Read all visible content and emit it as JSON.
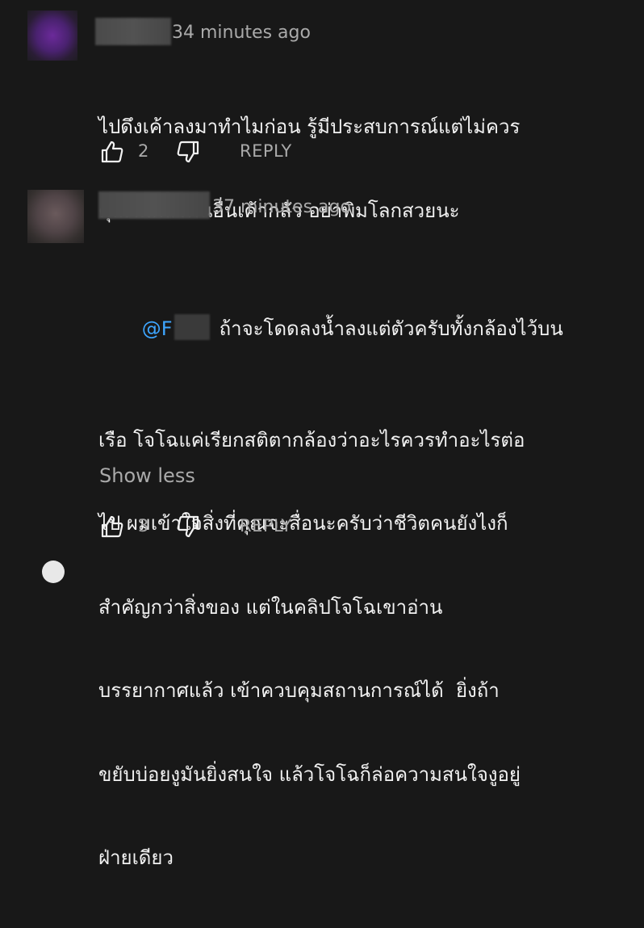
{
  "comments": [
    {
      "time": "34 minutes ago",
      "lines": [
        "ไปดึงเค้าลงมาทำไมก่อน รู้มีประสบการณ์แต่ไม่ควร",
        "คุณไม่กลัวคนอื่นเค้ากลัว อย่าพิมโลกสวยนะ"
      ],
      "like_count": "2",
      "reply_label": "REPLY"
    },
    {
      "time": "37 minutes ago",
      "mention": "@F",
      "first_line": "ถ้าจะโดดลงน้ำลงแต่ตัวครับทั้งกล้องไว้บน",
      "lines": [
        "เรือ โจโฉแค่เรียกสติตากล้องว่าอะไรควรทำอะไรต่อ",
        "ไป ผมเข้าใจสิ่งที่คุณจะสื่อนะครับว่าชีวิตคนยังไงก็",
        "สำคัญกว่าสิ่งของ แต่ในคลิปโจโฉเขาอ่าน",
        "บรรยากาศแล้ว เข้าควบคุมสถานการณ์ได้  ยิ่งถ้า",
        "ขยับบ่อยงูมันยิ่งสนใจ แล้วโจโฉก็ล่อความสนใจงูอยู่",
        "ฝ่ายเดียว"
      ],
      "show_less": "Show less",
      "like_count": "3",
      "reply_label": "REPLY"
    }
  ]
}
